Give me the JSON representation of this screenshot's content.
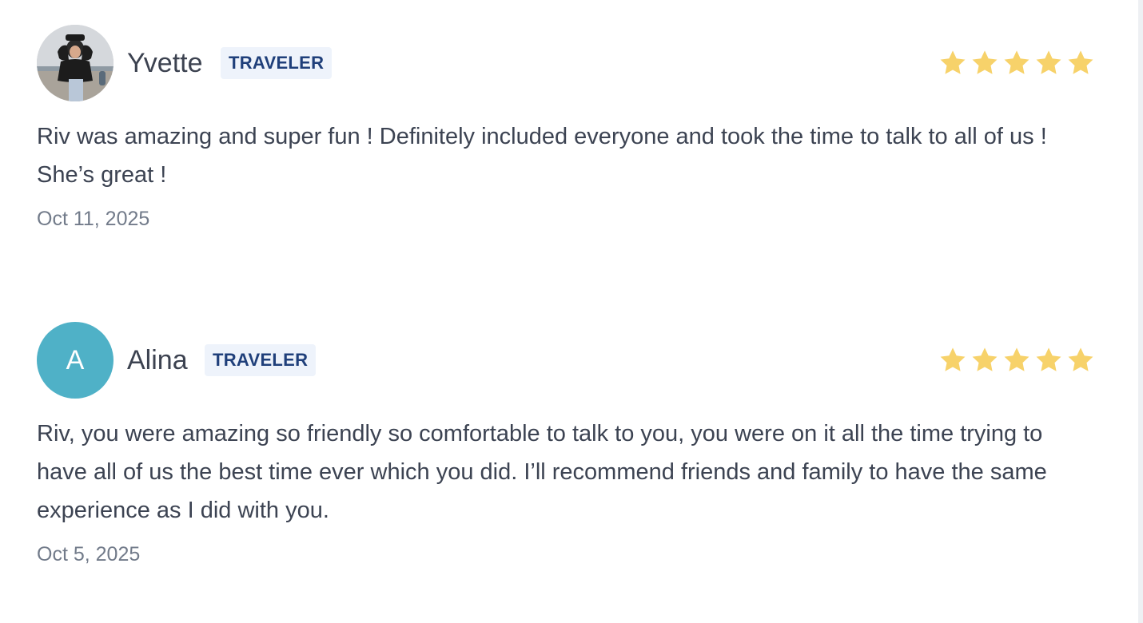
{
  "colors": {
    "star": "#f7d26a",
    "badge_bg": "#eef3fb",
    "badge_text": "#1f3f7a",
    "avatar_initial_bg": "#4fb1c7",
    "text": "#3c4352",
    "date": "#727b8a"
  },
  "reviews": [
    {
      "name": "Yvette",
      "badge": "TRAVELER",
      "avatar": {
        "type": "photo",
        "icon": "profile-photo"
      },
      "rating": 5,
      "rating_max": 5,
      "text": "Riv was amazing and super fun ! Definitely included everyone and took the time to talk to all of us ! She’s great !",
      "date": "Oct 11, 2025"
    },
    {
      "name": "Alina",
      "badge": "TRAVELER",
      "avatar": {
        "type": "initial",
        "initial": "A"
      },
      "rating": 5,
      "rating_max": 5,
      "text": "Riv, you were amazing so friendly so comfortable to talk to you, you were on it all the time trying to have all of us the best time ever which you did. I’ll recommend friends and family to have the same experience as I did with you.",
      "date": "Oct 5, 2025"
    }
  ]
}
